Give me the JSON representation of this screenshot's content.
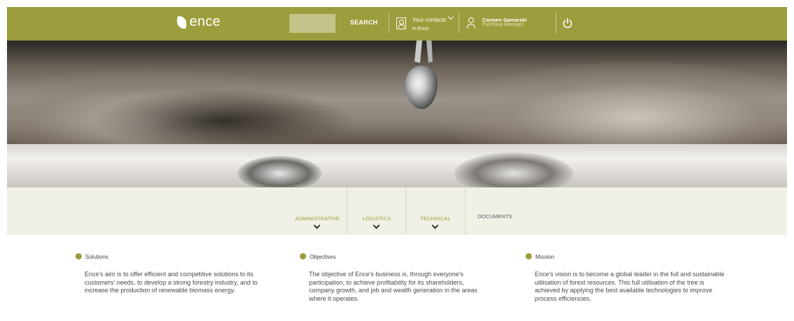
{
  "colors": {
    "accent": "#9c9d3c",
    "accent_light": "#c3c48a",
    "tabs_background": "#f0f0e6",
    "tab_active_text": "#9c9d3c",
    "tab_plain_text": "#4a5a6a"
  },
  "header": {
    "logo_text": "ence",
    "logo_icon": "leaf-logo-icon",
    "search_label": "SEARCH",
    "search_value": "",
    "contacts": {
      "title": "Your contacts",
      "subtitle": "In Ence",
      "icon": "contact-book-icon",
      "dropdown_icon": "chevron-down-icon"
    },
    "user": {
      "name": "Carmen Samorski",
      "role": "Purchase Manager",
      "icon": "user-icon"
    },
    "logout_icon": "power-icon"
  },
  "hero": {
    "image_description_icon": "faucet-drop-photo"
  },
  "tabs": [
    {
      "label": "ADMINISTRATIVE",
      "has_dropdown": true
    },
    {
      "label": "LOGISTICS",
      "has_dropdown": true
    },
    {
      "label": "TECHNICAL",
      "has_dropdown": true
    },
    {
      "label": "DOCUMENTS",
      "has_dropdown": false
    }
  ],
  "sections": [
    {
      "title": "Solutions",
      "text": "Ence's aim is to offer efficient and competitive solutions to its customers' needs, to develop a strong forestry industry, and to increase the production of renewable biomass energy."
    },
    {
      "title": "Objectives",
      "text": "The objective of Ence's business is, through everyone's participation, to achieve profitability for its shareholders, company growth, and job and wealth generation in the areas where it operates."
    },
    {
      "title": "Mission",
      "text": "Ence's vision is to become a global leader in the full and sustainable utilisation of forest resources. This full utilisation of the tree is achieved by applying the best available technologies to improve process efficiencies."
    }
  ]
}
